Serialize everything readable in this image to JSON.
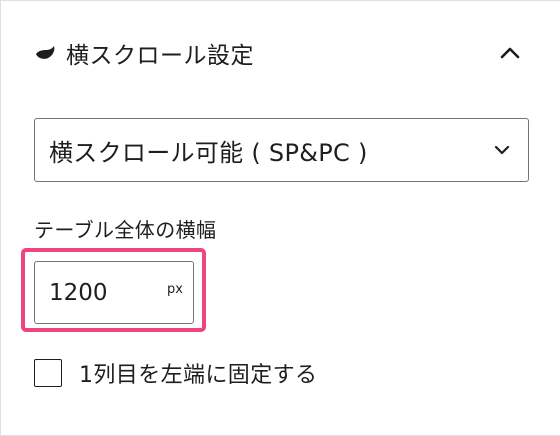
{
  "panel": {
    "title": "横スクロール設定",
    "icon": "swell-logo-icon",
    "expanded": true
  },
  "scroll_select": {
    "value": "横スクロール可能 ( SP&PC )"
  },
  "table_width": {
    "label": "テーブル全体の横幅",
    "value": "1200",
    "unit": "px"
  },
  "fix_first_column": {
    "label": "1列目を左端に固定する",
    "checked": false
  },
  "colors": {
    "highlight": "#f0447e",
    "border": "#757575",
    "text": "#1e1e1e"
  }
}
